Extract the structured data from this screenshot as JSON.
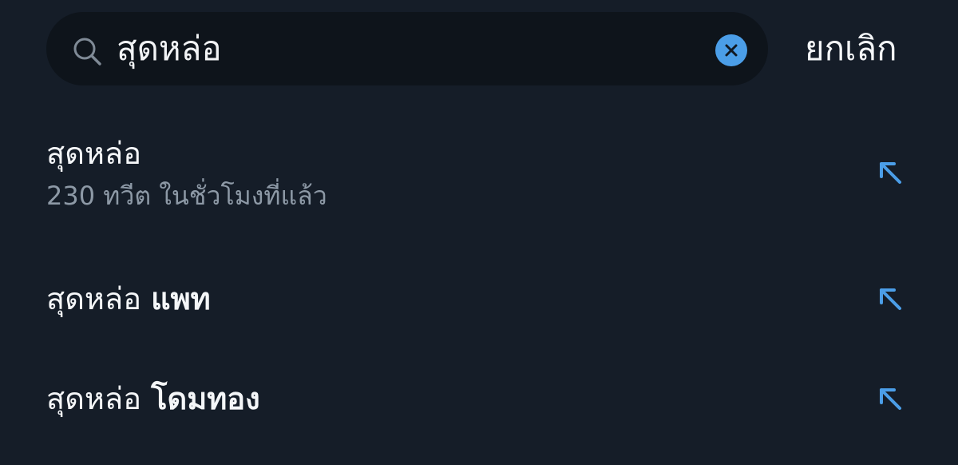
{
  "search": {
    "value": "สุดหล่อ",
    "placeholder": "",
    "cancel_label": "ยกเลิก",
    "icon": "search-icon",
    "clear_icon": "clear-icon"
  },
  "suggestions": [
    {
      "query": "สุดหล่อ",
      "completion": "",
      "meta": "230 ทวีต ในชั่วโมงที่แล้ว",
      "icon": "arrow-up-left-icon"
    },
    {
      "query": "สุดหล่อ",
      "completion": "แพท",
      "meta": "",
      "icon": "arrow-up-left-icon"
    },
    {
      "query": "สุดหล่อ",
      "completion": "โดมทอง",
      "meta": "",
      "icon": "arrow-up-left-icon"
    }
  ],
  "colors": {
    "background": "#151d28",
    "search_box": "#0e141b",
    "accent": "#4b9ee8",
    "primary_text": "#f4f6f8",
    "secondary_text": "#8d99a6"
  }
}
